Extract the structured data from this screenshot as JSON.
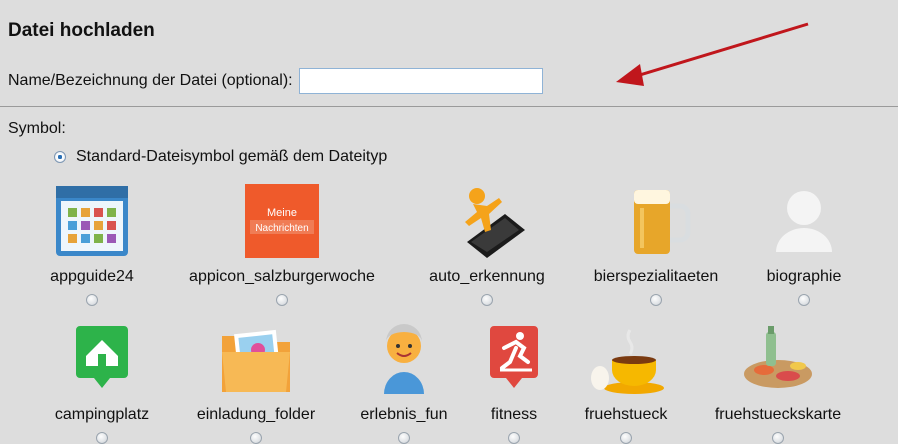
{
  "form": {
    "title": "Datei hochladen",
    "name_label": "Name/Bezeichnung der Datei (optional):",
    "name_value": "",
    "name_placeholder": ""
  },
  "symbol": {
    "label": "Symbol:",
    "standard_option": "Standard-Dateisymbol gemäß dem Dateityp",
    "standard_selected": true
  },
  "icons": [
    {
      "name": "appguide24",
      "icon": "app-grid-icon",
      "selected": false
    },
    {
      "name": "appicon_salzburgerwoche",
      "icon": "news-tile-icon",
      "badge_line1": "Meine",
      "badge_line2": "Nachrichten",
      "selected": false
    },
    {
      "name": "auto_erkennung",
      "icon": "person-on-phone-icon",
      "selected": false
    },
    {
      "name": "bierspezialitaeten",
      "icon": "beer-mug-icon",
      "selected": false
    },
    {
      "name": "biographie",
      "icon": "person-silhouette-icon",
      "selected": false
    },
    {
      "name": "campingplatz",
      "icon": "camper-van-icon",
      "selected": false
    },
    {
      "name": "einladung_folder",
      "icon": "folder-photo-icon",
      "selected": false
    },
    {
      "name": "erlebnis_fun",
      "icon": "smiley-avatar-icon",
      "selected": false
    },
    {
      "name": "fitness",
      "icon": "running-person-icon",
      "selected": false
    },
    {
      "name": "fruehstueck",
      "icon": "coffee-cup-egg-icon",
      "selected": false
    },
    {
      "name": "fruehstueckskarte",
      "icon": "breakfast-plate-icon",
      "selected": false
    }
  ],
  "colors": {
    "background": "#dddddd",
    "arrow": "#c0161c",
    "input_border": "#8fb3d6"
  }
}
